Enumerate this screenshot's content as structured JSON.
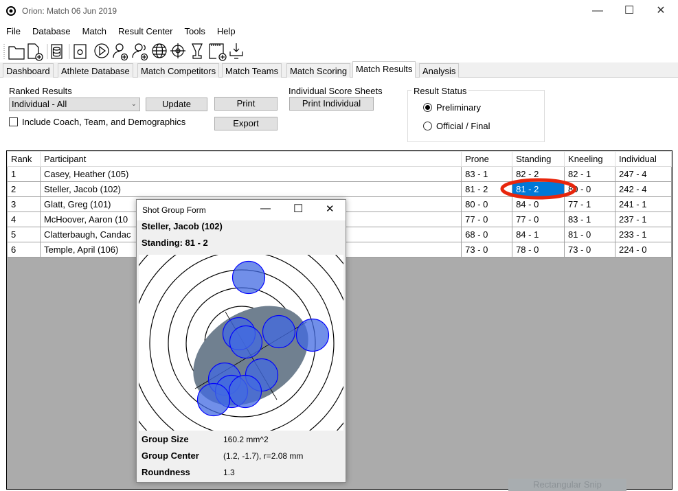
{
  "window": {
    "title": "Orion: Match 06 Jun 2019",
    "controls": [
      "minimize",
      "maximize",
      "close"
    ]
  },
  "menu": [
    "File",
    "Database",
    "Match",
    "Result Center",
    "Tools",
    "Help"
  ],
  "toolbar_icons": [
    "folder-icon",
    "new-file-icon",
    "database-icon",
    "settings-file-icon",
    "play-icon",
    "add-athlete-icon",
    "add-team-icon",
    "globe-icon",
    "target-icon",
    "trophy-icon",
    "new-card-icon",
    "download-icon"
  ],
  "tabs": [
    {
      "label": "Dashboard"
    },
    {
      "label": "Athlete Database"
    },
    {
      "label": "Match Competitors"
    },
    {
      "label": "Match Teams"
    },
    {
      "label": "Match Scoring"
    },
    {
      "label": "Match Results",
      "active": true
    },
    {
      "label": "Analysis"
    }
  ],
  "controls": {
    "ranked_label": "Ranked Results",
    "ranked_value": "Individual - All",
    "update": "Update",
    "print": "Print",
    "export": "Export",
    "include_label": "Include Coach, Team, and Demographics",
    "include_checked": false,
    "sheets_label": "Individual Score Sheets",
    "print_individual": "Print Individual",
    "status_label": "Result Status",
    "status_options": [
      "Preliminary",
      "Official / Final"
    ],
    "status_selected": "Preliminary"
  },
  "table": {
    "headers": [
      "Rank",
      "Participant",
      "Prone",
      "Standing",
      "Kneeling",
      "Individual"
    ],
    "rows": [
      [
        "1",
        "Casey, Heather (105)",
        "83 - 1",
        "82 - 2",
        "82 - 1",
        "247 - 4"
      ],
      [
        "2",
        "Steller, Jacob (102)",
        "81 - 2",
        "81 - 2",
        "80 - 0",
        "242 - 4"
      ],
      [
        "3",
        "Glatt, Greg (101)",
        "80 - 0",
        "84 - 0",
        "77 - 1",
        "241 - 1"
      ],
      [
        "4",
        "McHoover, Aaron (10",
        "77 - 0",
        "77 - 0",
        "83 - 1",
        "237 - 1"
      ],
      [
        "5",
        "Clatterbaugh, Candac",
        "68 - 0",
        "84 - 1",
        "81 - 0",
        "233 - 1"
      ],
      [
        "6",
        "Temple, April (106)",
        "73 - 0",
        "78 - 0",
        "73 - 0",
        "224 - 0"
      ]
    ],
    "selected_cell": "row 2, Standing",
    "highlight_color": "#0078d7",
    "annotation_color": "#e8260c"
  },
  "dialog": {
    "title": "Shot Group Form",
    "athlete": "Steller, Jacob (102)",
    "stage": "Standing: 81 - 2",
    "stats": [
      {
        "label": "Group Size",
        "value": "160.2 mm^2"
      },
      {
        "label": "Group Center",
        "value": "(1.2, -1.7), r=2.08 mm"
      },
      {
        "label": "Roundness",
        "value": "1.3"
      }
    ],
    "shot_color": "#4169e1",
    "ellipse_color": "#708090"
  },
  "tooltip": "Rectangular Snip"
}
